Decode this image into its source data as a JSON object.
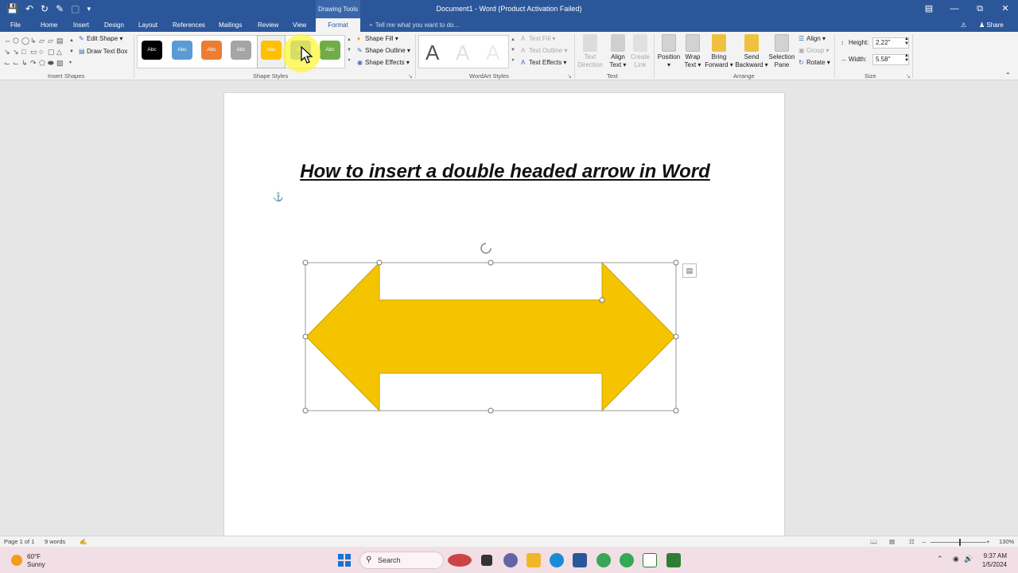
{
  "titlebar": {
    "document_title": "Document1 - Word (Product Activation Failed)",
    "context_tools": "Drawing Tools",
    "quick_access": [
      "save-icon",
      "undo-icon",
      "redo-icon",
      "touch-mode-icon",
      "customize-icon"
    ]
  },
  "tabs": {
    "file": "File",
    "home": "Home",
    "insert": "Insert",
    "design": "Design",
    "layout": "Layout",
    "references": "References",
    "mailings": "Mailings",
    "review": "Review",
    "view": "View",
    "format": "Format",
    "tell_me": "Tell me what you want to do...",
    "share": "Share"
  },
  "ribbon": {
    "insert_shapes": {
      "label": "Insert Shapes",
      "edit_shape": "Edit Shape",
      "draw_text_box": "Draw Text Box"
    },
    "shape_styles": {
      "label": "Shape Styles",
      "style_text": "Abc",
      "styles": [
        {
          "bg": "#000000",
          "fg": "#ffffff"
        },
        {
          "bg": "#5b9bd5",
          "fg": "#ffffff"
        },
        {
          "bg": "#ed7d31",
          "fg": "#ffffff"
        },
        {
          "bg": "#a5a5a5",
          "fg": "#ffffff"
        },
        {
          "bg": "#ffc000",
          "fg": "#ffffff"
        },
        {
          "bg": "#5b9bd5",
          "fg": "#ffffff"
        },
        {
          "bg": "#70ad47",
          "fg": "#ffffff"
        }
      ],
      "shape_fill": "Shape Fill",
      "shape_outline": "Shape Outline",
      "shape_effects": "Shape Effects"
    },
    "wordart_styles": {
      "label": "WordArt Styles",
      "letter": "A",
      "text_fill": "Text Fill",
      "text_outline": "Text Outline",
      "text_effects": "Text Effects"
    },
    "text": {
      "label": "Text",
      "text_direction": [
        "Text",
        "Direction"
      ],
      "align_text": [
        "Align",
        "Text"
      ],
      "create_link": [
        "Create",
        "Link"
      ]
    },
    "arrange": {
      "label": "Arrange",
      "position": "Position",
      "wrap_text": [
        "Wrap",
        "Text"
      ],
      "bring_forward": [
        "Bring",
        "Forward"
      ],
      "send_backward": [
        "Send",
        "Backward"
      ],
      "selection_pane": [
        "Selection",
        "Pane"
      ],
      "align": "Align",
      "group": "Group",
      "rotate": "Rotate"
    },
    "size": {
      "label": "Size",
      "height_label": "Height:",
      "height_value": "2.22\"",
      "width_label": "Width:",
      "width_value": "5.58\""
    }
  },
  "document": {
    "heading": "How to insert a double headed arrow in Word",
    "shape_fill_color": "#f5c400",
    "shape_outline_color": "#c9a100"
  },
  "statusbar": {
    "page": "Page 1 of 1",
    "words": "9 words",
    "zoom": "130%"
  },
  "taskbar": {
    "temperature": "60°F",
    "weather": "Sunny",
    "search_placeholder": "Search",
    "time": "9:37 AM",
    "date": "1/5/2024"
  }
}
